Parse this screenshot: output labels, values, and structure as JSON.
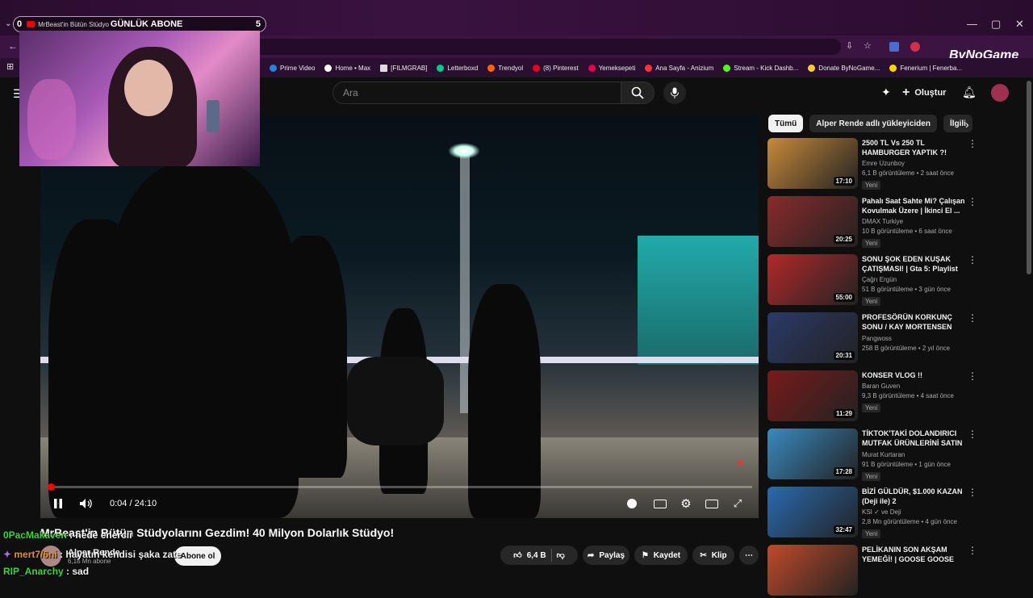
{
  "browser": {
    "tab": {
      "count_left": "0",
      "title": "MrBeast'in Bütün Stüdyo",
      "daily_label": "GÜNLÜK ABONE",
      "count_right": "5"
    },
    "bookmarks": [
      "Prime Video",
      "Home • Max",
      "[FILMGRAB]",
      "Letterboxd",
      "Trendyol",
      "(8) Pinterest",
      "Yemeksepeti",
      "Ana Sayfa - Anizium",
      "Stream - Kick Dashb...",
      "Donate ByNoGame...",
      "Fenerium | Fenerba..."
    ],
    "watermark": "ByNoGame"
  },
  "youtube": {
    "search_placeholder": "Ara",
    "create_label": "Oluştur"
  },
  "player": {
    "progress": 0.003,
    "time": "0:04 / 24:10"
  },
  "video": {
    "title": "MrBeast'in Bütün Stüdyolarını Gezdim! 40 Milyon Dolarlık Stüdyo!",
    "channel": "Alper Rende",
    "subs": "6,18 Mn abone",
    "subscribe_label": "Abone ol",
    "likes": "6,4 B",
    "share_label": "Paylaş",
    "save_label": "Kaydet",
    "clip_label": "Klip"
  },
  "chat": [
    {
      "user": "0PacMakaven",
      "text": "hede enercii",
      "color": "#3fd43f"
    },
    {
      "user": "mert7/6ni",
      "text": "hayatın kendisi şaka zate",
      "color": "#e0902c"
    },
    {
      "user": "RIP_Anarchy",
      "text": "sad",
      "color": "#3fd43f"
    }
  ],
  "chips": [
    "Tümü",
    "Alper Rende adlı yükleyiciden",
    "İlgili"
  ],
  "recommendations": [
    {
      "title": "2500 TL Vs 250 TL HAMBURGER YAPTIK ?!",
      "channel": "Emre Uzunboy",
      "meta": "6,1 B görüntüleme • 2 saat önce",
      "badge": "Yeni",
      "duration": "17:10",
      "color": "#c98a3a"
    },
    {
      "title": "Pahalı Saat Sahte Mi? Çalışan Kovulmak Üzere | İkinci El ...",
      "channel": "DMAX Turkiye",
      "meta": "10 B görüntüleme • 6 saat önce",
      "badge": "Yeni",
      "duration": "20:25",
      "color": "#8a2a2a"
    },
    {
      "title": "SONU ŞOK EDEN KUŞAK ÇATIŞMASI! | Gta 5: Playlist",
      "channel": "Çağrı Ergün",
      "meta": "51 B görüntüleme • 3 gün önce",
      "badge": "Yeni",
      "duration": "55:00",
      "color": "#b3282a"
    },
    {
      "title": "PROFESÖRÜN KORKUNÇ SONU / KAY MORTENSEN DAVASI / ...",
      "channel": "Pangwoss",
      "meta": "258 B görüntüleme • 2 yıl önce",
      "badge": "",
      "duration": "20:31",
      "color": "#2a3a6a"
    },
    {
      "title": "KONSER VLOG !!",
      "channel": "Baran Guven",
      "meta": "9,3 B görüntüleme • 4 saat önce",
      "badge": "Yeni",
      "duration": "11:29",
      "color": "#7a1a1a"
    },
    {
      "title": "TİKTOK'TAKİ DOLANDIRICI MUTFAK ÜRÜNLERİNİ SATIN ...",
      "channel": "Murat Kurtaran",
      "meta": "91 B görüntüleme • 1 gün önce",
      "badge": "Yeni",
      "duration": "17:28",
      "color": "#3a8ac0"
    },
    {
      "title": "BİZİ GÜLDÜR, $1.000 KAZAN (Deji ile) 2",
      "channel": "KSI ✓ ve Deji",
      "meta": "2,8 Mn görüntüleme • 4 gün önce",
      "badge": "Yeni",
      "duration": "32:47",
      "color": "#2a6ab0"
    },
    {
      "title": "PELİKANIN SON AKŞAM YEMEĞİ! | GOOSE GOOSE DUC...",
      "channel": "",
      "meta": "",
      "badge": "",
      "duration": "",
      "color": "#c04a2a"
    }
  ]
}
